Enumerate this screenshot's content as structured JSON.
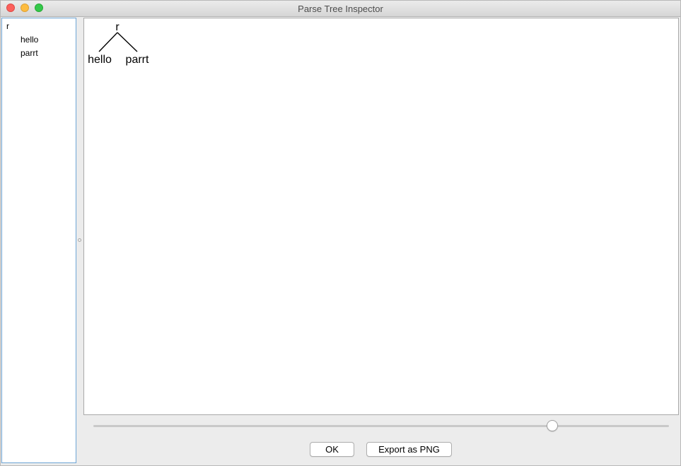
{
  "window": {
    "title": "Parse Tree Inspector"
  },
  "tree_view": {
    "root": "r",
    "children": [
      "hello",
      "parrt"
    ]
  },
  "parse_tree": {
    "root": "r",
    "children": [
      "hello",
      "parrt"
    ]
  },
  "zoom_slider": {
    "value_fraction": 0.8
  },
  "buttons": {
    "ok": "OK",
    "export": "Export as PNG"
  },
  "colors": {
    "close": "#fc605c",
    "minimize": "#fdbc40",
    "maximize": "#34c84a",
    "tree_border": "#6fa6d6"
  }
}
